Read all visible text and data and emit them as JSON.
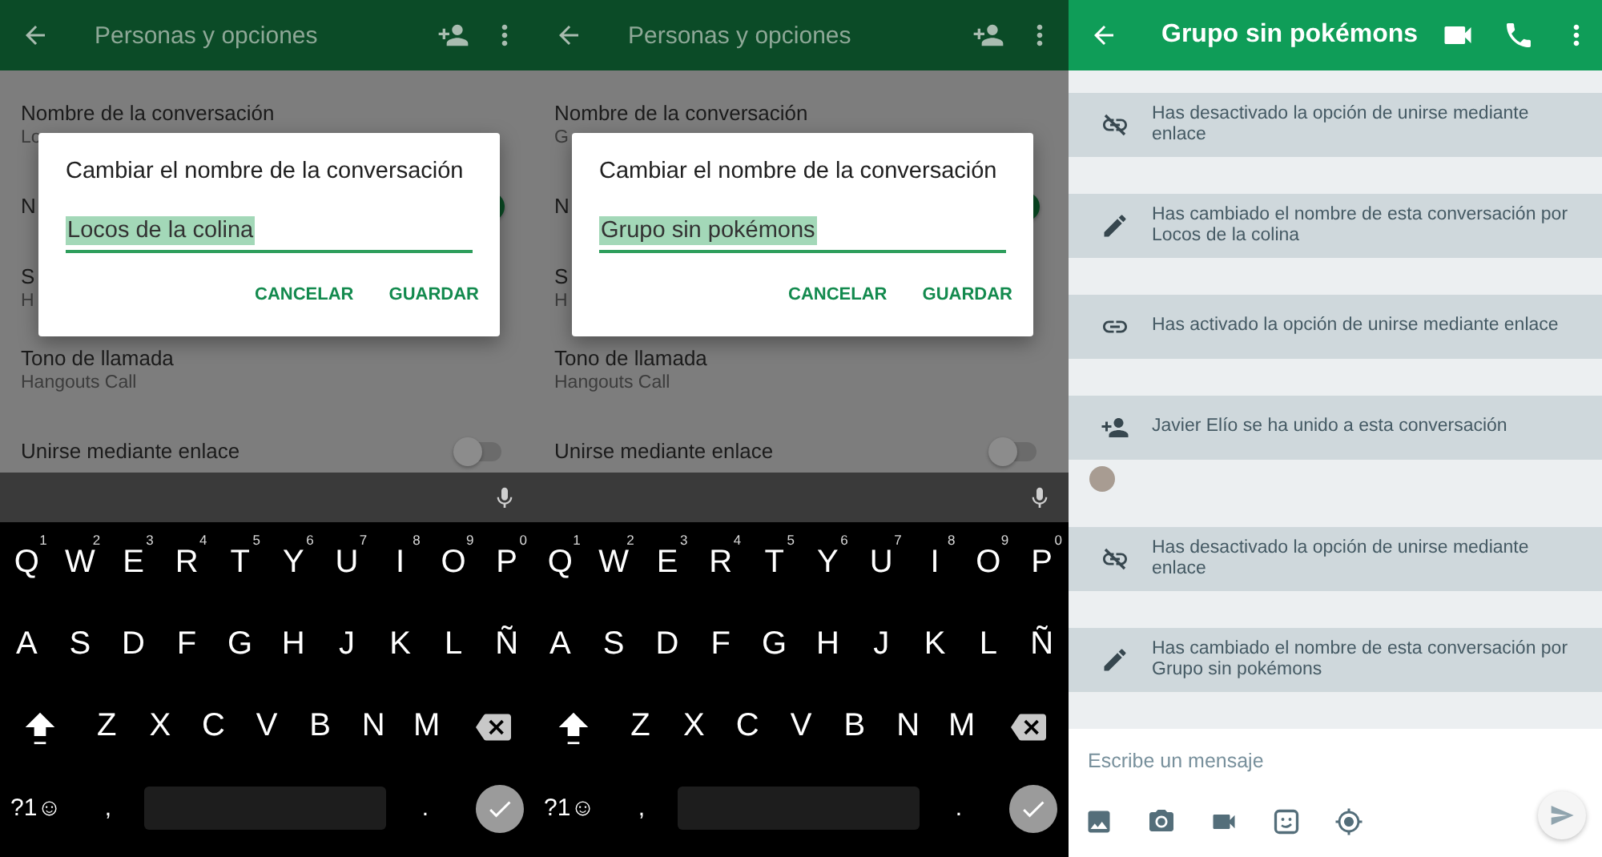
{
  "panes": [
    {
      "kind": "options",
      "app_bar": {
        "title": "Personas y opciones"
      },
      "settings": [
        {
          "kind": "text",
          "title": "Nombre de la conversación",
          "subtitle": "Lo"
        },
        {
          "kind": "toggle",
          "title": "N",
          "on": true
        },
        {
          "kind": "text",
          "title": "S",
          "subtitle": "H"
        },
        {
          "kind": "text",
          "title": "Tono de llamada",
          "subtitle": "Hangouts Call"
        },
        {
          "kind": "toggle",
          "title": "Unirse mediante enlace",
          "on": false
        }
      ],
      "dialog": {
        "title": "Cambiar el nombre de la conversación",
        "value": "Locos de la colina",
        "value_selected": true,
        "buttons": [
          "CANCELAR",
          "GUARDAR"
        ]
      },
      "keyboard": {
        "rows": [
          [
            {
              "kind": "char",
              "label": "Q",
              "hint": "1"
            },
            {
              "kind": "char",
              "label": "W",
              "hint": "2"
            },
            {
              "kind": "char",
              "label": "E",
              "hint": "3"
            },
            {
              "kind": "char",
              "label": "R",
              "hint": "4"
            },
            {
              "kind": "char",
              "label": "T",
              "hint": "5"
            },
            {
              "kind": "char",
              "label": "Y",
              "hint": "6"
            },
            {
              "kind": "char",
              "label": "U",
              "hint": "7"
            },
            {
              "kind": "char",
              "label": "I",
              "hint": "8"
            },
            {
              "kind": "char",
              "label": "O",
              "hint": "9"
            },
            {
              "kind": "char",
              "label": "P",
              "hint": "0"
            }
          ],
          [
            {
              "kind": "char",
              "label": "A"
            },
            {
              "kind": "char",
              "label": "S"
            },
            {
              "kind": "char",
              "label": "D"
            },
            {
              "kind": "char",
              "label": "F"
            },
            {
              "kind": "char",
              "label": "G"
            },
            {
              "kind": "char",
              "label": "H"
            },
            {
              "kind": "char",
              "label": "J"
            },
            {
              "kind": "char",
              "label": "K"
            },
            {
              "kind": "char",
              "label": "L"
            },
            {
              "kind": "char",
              "label": "Ñ"
            }
          ],
          [
            {
              "kind": "shift"
            },
            {
              "kind": "char",
              "label": "Z"
            },
            {
              "kind": "char",
              "label": "X"
            },
            {
              "kind": "char",
              "label": "C"
            },
            {
              "kind": "char",
              "label": "V"
            },
            {
              "kind": "char",
              "label": "B"
            },
            {
              "kind": "char",
              "label": "N"
            },
            {
              "kind": "char",
              "label": "M"
            },
            {
              "kind": "backspace"
            }
          ],
          [
            {
              "kind": "char",
              "label": "?1☺"
            },
            {
              "kind": "char",
              "label": ","
            },
            {
              "kind": "space"
            },
            {
              "kind": "char",
              "label": "."
            },
            {
              "kind": "enter"
            }
          ]
        ]
      }
    },
    {
      "kind": "options",
      "app_bar": {
        "title": "Personas y opciones"
      },
      "settings": [
        {
          "kind": "text",
          "title": "Nombre de la conversación",
          "subtitle": "G"
        },
        {
          "kind": "toggle",
          "title": "N",
          "on": true
        },
        {
          "kind": "text",
          "title": "S",
          "subtitle": "H"
        },
        {
          "kind": "text",
          "title": "Tono de llamada",
          "subtitle": "Hangouts Call"
        },
        {
          "kind": "toggle",
          "title": "Unirse mediante enlace",
          "on": false
        }
      ],
      "dialog": {
        "title": "Cambiar el nombre de la conversación",
        "value": "Grupo sin pokémons",
        "value_selected": true,
        "buttons": [
          "CANCELAR",
          "GUARDAR"
        ]
      },
      "keyboard": {
        "rows": [
          [
            {
              "kind": "char",
              "label": "Q",
              "hint": "1"
            },
            {
              "kind": "char",
              "label": "W",
              "hint": "2"
            },
            {
              "kind": "char",
              "label": "E",
              "hint": "3"
            },
            {
              "kind": "char",
              "label": "R",
              "hint": "4"
            },
            {
              "kind": "char",
              "label": "T",
              "hint": "5"
            },
            {
              "kind": "char",
              "label": "Y",
              "hint": "6"
            },
            {
              "kind": "char",
              "label": "U",
              "hint": "7"
            },
            {
              "kind": "char",
              "label": "I",
              "hint": "8"
            },
            {
              "kind": "char",
              "label": "O",
              "hint": "9"
            },
            {
              "kind": "char",
              "label": "P",
              "hint": "0"
            }
          ],
          [
            {
              "kind": "char",
              "label": "A"
            },
            {
              "kind": "char",
              "label": "S"
            },
            {
              "kind": "char",
              "label": "D"
            },
            {
              "kind": "char",
              "label": "F"
            },
            {
              "kind": "char",
              "label": "G"
            },
            {
              "kind": "char",
              "label": "H"
            },
            {
              "kind": "char",
              "label": "J"
            },
            {
              "kind": "char",
              "label": "K"
            },
            {
              "kind": "char",
              "label": "L"
            },
            {
              "kind": "char",
              "label": "Ñ"
            }
          ],
          [
            {
              "kind": "shift"
            },
            {
              "kind": "char",
              "label": "Z"
            },
            {
              "kind": "char",
              "label": "X"
            },
            {
              "kind": "char",
              "label": "C"
            },
            {
              "kind": "char",
              "label": "V"
            },
            {
              "kind": "char",
              "label": "B"
            },
            {
              "kind": "char",
              "label": "N"
            },
            {
              "kind": "char",
              "label": "M"
            },
            {
              "kind": "backspace"
            }
          ],
          [
            {
              "kind": "char",
              "label": "?1☺"
            },
            {
              "kind": "char",
              "label": ","
            },
            {
              "kind": "space"
            },
            {
              "kind": "char",
              "label": "."
            },
            {
              "kind": "enter"
            }
          ]
        ]
      }
    },
    {
      "kind": "chat",
      "app_bar": {
        "title": "Grupo sin pokémons"
      },
      "events": [
        {
          "kind": "link-off",
          "text": "Has desactivado la opción de unirse mediante enlace"
        },
        {
          "kind": "rename",
          "text": "Has cambiado el nombre de esta conversación por Locos de la colina"
        },
        {
          "kind": "link-on",
          "text": "Has activado la opción de unirse mediante enlace"
        },
        {
          "kind": "joined",
          "text": "Javier Elío se ha unido a esta conversación"
        },
        {
          "kind": "avatar"
        },
        {
          "kind": "link-off",
          "text": "Has desactivado la opción de unirse mediante enlace"
        },
        {
          "kind": "rename",
          "text": "Has cambiado el nombre de esta conversación por Grupo sin pokémons"
        }
      ],
      "composer": {
        "placeholder": "Escribe un mensaje"
      }
    }
  ]
}
